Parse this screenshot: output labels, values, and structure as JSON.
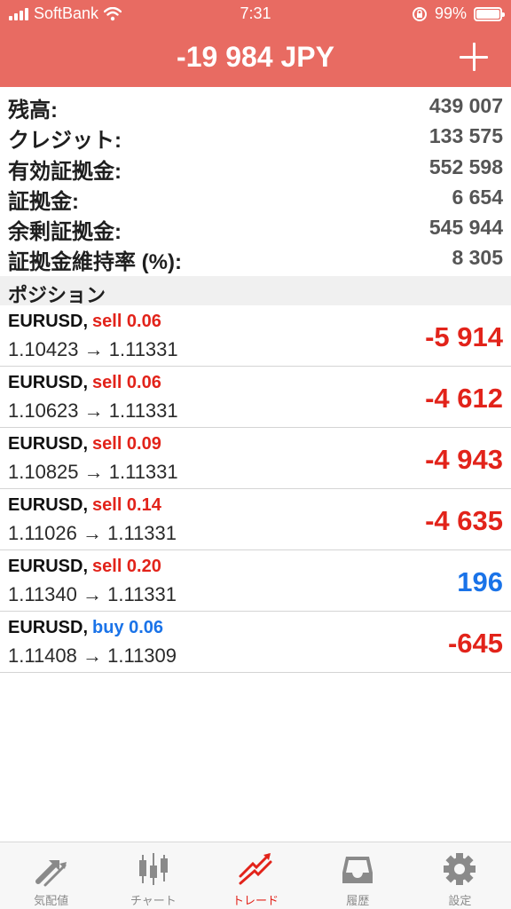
{
  "status_bar": {
    "carrier": "SoftBank",
    "time": "7:31",
    "battery": "99%",
    "battery_level": 0.99,
    "icons": [
      "signal-icon",
      "wifi-icon",
      "orientation-lock-icon",
      "battery-icon"
    ]
  },
  "header": {
    "title": "-19 984 JPY",
    "action_icon": "plus-icon"
  },
  "summary": [
    {
      "label": "残高:",
      "value": "439 007"
    },
    {
      "label": "クレジット:",
      "value": "133 575"
    },
    {
      "label": "有効証拠金:",
      "value": "552 598"
    },
    {
      "label": "証拠金:",
      "value": "6 654"
    },
    {
      "label": "余剰証拠金:",
      "value": "545 944"
    },
    {
      "label": "証拠金維持率 (%):",
      "value": "8 305"
    }
  ],
  "positions_section": {
    "title": "ポジション"
  },
  "positions": [
    {
      "symbol": "EURUSD,",
      "side": "sell 0.06",
      "side_color": "#e2231a",
      "prices": "1.10423 → 1.11331",
      "profit": "-5 914",
      "profit_color": "#e2231a"
    },
    {
      "symbol": "EURUSD,",
      "side": "sell 0.06",
      "side_color": "#e2231a",
      "prices": "1.10623 → 1.11331",
      "profit": "-4 612",
      "profit_color": "#e2231a"
    },
    {
      "symbol": "EURUSD,",
      "side": "sell 0.09",
      "side_color": "#e2231a",
      "prices": "1.10825 → 1.11331",
      "profit": "-4 943",
      "profit_color": "#e2231a"
    },
    {
      "symbol": "EURUSD,",
      "side": "sell 0.14",
      "side_color": "#e2231a",
      "prices": "1.11026 → 1.11331",
      "profit": "-4 635",
      "profit_color": "#e2231a"
    },
    {
      "symbol": "EURUSD,",
      "side": "sell 0.20",
      "side_color": "#e2231a",
      "prices": "1.11340 → 1.11331",
      "profit": "196",
      "profit_color": "#1a73e8"
    },
    {
      "symbol": "EURUSD,",
      "side": "buy 0.06",
      "side_color": "#1a73e8",
      "prices": "1.11408 → 1.11309",
      "profit": "-645",
      "profit_color": "#e2231a"
    }
  ],
  "tabs": [
    {
      "label": "気配値",
      "icon": "quotes-icon",
      "active": false
    },
    {
      "label": "チャート",
      "icon": "chart-icon",
      "active": false
    },
    {
      "label": "トレード",
      "icon": "trade-icon",
      "active": true
    },
    {
      "label": "履歴",
      "icon": "history-icon",
      "active": false
    },
    {
      "label": "設定",
      "icon": "settings-icon",
      "active": false
    }
  ],
  "colors": {
    "header_bg": "#e86b62",
    "negative": "#e2231a",
    "positive": "#1a73e8"
  }
}
